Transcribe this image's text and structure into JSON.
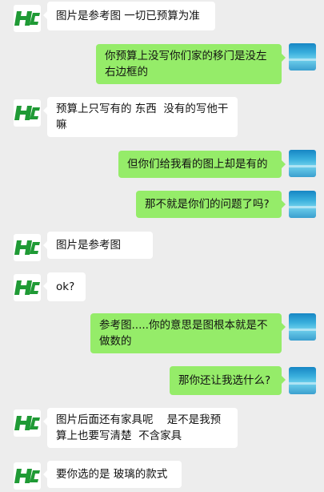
{
  "colors": {
    "background": "#ededed",
    "incoming_bubble": "#ffffff",
    "outgoing_bubble": "#95ec69",
    "logo_green": "#1f9a35"
  },
  "messages": [
    {
      "side": "left",
      "text": "图片是参考图 一切已预算为准"
    },
    {
      "side": "right",
      "text": "你预算上没写你们家的移门是没左右边框的"
    },
    {
      "side": "left",
      "text": "预算上只写有的 东西  没有的写他干嘛"
    },
    {
      "side": "right",
      "text": "但你们给我看的图上却是有的"
    },
    {
      "side": "right",
      "text": "那不就是你们的问题了吗?"
    },
    {
      "side": "left",
      "text": "图片是参考图"
    },
    {
      "side": "left",
      "text": "ok?"
    },
    {
      "side": "right",
      "text": "参考图.....你的意思是图根本就是不做数的"
    },
    {
      "side": "right",
      "text": "那你还让我选什么?"
    },
    {
      "side": "left",
      "text": "图片后面还有家具呢    是不是我预算上也要写清楚  不含家具"
    },
    {
      "side": "left",
      "text": "要你选的是 玻璃的款式"
    }
  ]
}
